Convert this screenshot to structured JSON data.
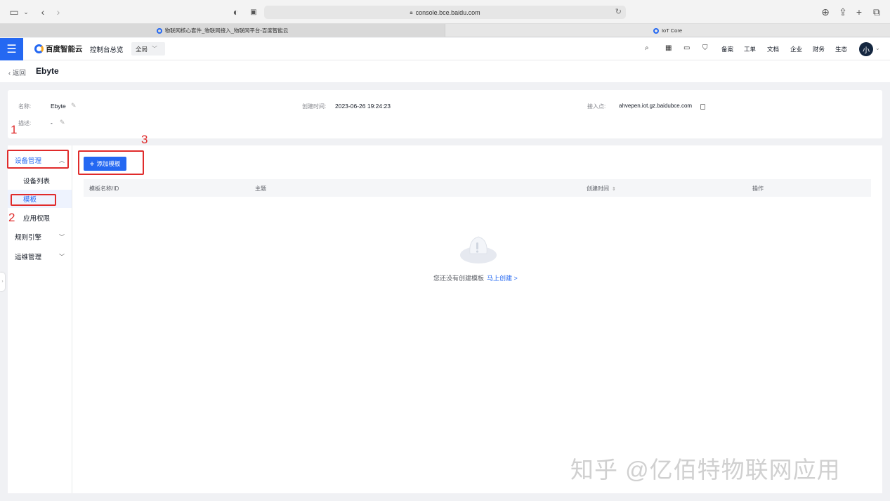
{
  "browser": {
    "url": "console.bce.baidu.com",
    "tabs": [
      {
        "label": "物联网核心套件_物联网接入_物联网平台-百度智能云",
        "active": true
      },
      {
        "label": "IoT Core",
        "active": false
      }
    ]
  },
  "header": {
    "logo": "百度智能云",
    "console": "控制台总览",
    "region": "全局",
    "nav": [
      "备案",
      "工单",
      "文档",
      "企业",
      "财务",
      "生态"
    ],
    "avatar": "小"
  },
  "page": {
    "back": "返回",
    "title": "Ebyte"
  },
  "info": {
    "name_label": "名称:",
    "name_value": "Ebyte",
    "desc_label": "描述:",
    "desc_value": "-",
    "created_label": "创建时间:",
    "created_value": "2023-06-26 19:24:23",
    "endpoint_label": "接入点:",
    "endpoint_value": "ahvepen.iot.gz.baidubce.com"
  },
  "sidebar": {
    "device_mgmt": "设备管理",
    "device_list": "设备列表",
    "template": "模板",
    "app_permission": "应用权限",
    "rule_engine": "规则引擎",
    "ops_mgmt": "运维管理"
  },
  "toolbar": {
    "add_template": "添加模板"
  },
  "table": {
    "columns": [
      "模板名称/ID",
      "主题",
      "创建时间",
      "操作"
    ]
  },
  "empty": {
    "text": "您还没有创建模板",
    "link": "马上创建 >"
  },
  "annotations": [
    "1",
    "2",
    "3"
  ],
  "watermark": "知乎 @亿佰特物联网应用",
  "colors": {
    "primary": "#2468f2",
    "annotation": "#e02b2b"
  }
}
